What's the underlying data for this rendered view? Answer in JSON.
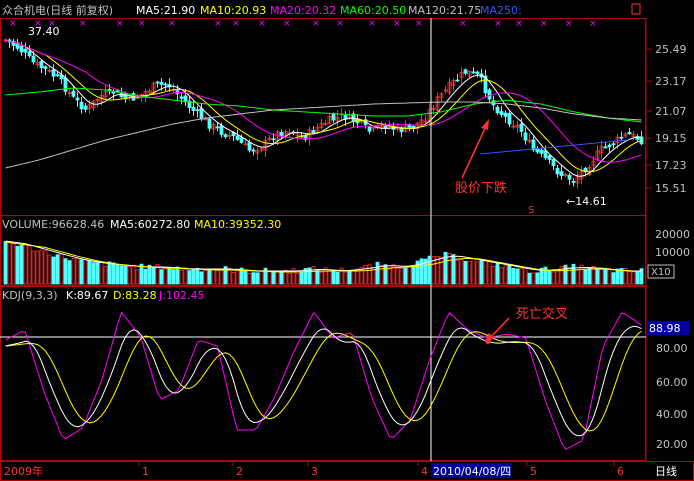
{
  "chart_data": {
    "type": "candlestick",
    "price_panel": {
      "title": "众合机电(日线 前复权)",
      "ma_labels": [
        {
          "text": "MA5:21.90",
          "color": "#ffffff"
        },
        {
          "text": "MA10:20.93",
          "color": "#ffff00"
        },
        {
          "text": "MA20:20.32",
          "color": "#ff00ff"
        },
        {
          "text": "MA60:20.50",
          "color": "#00ff00"
        },
        {
          "text": "MA120:21.75",
          "color": "#c0c0c0"
        },
        {
          "text": "MA250:",
          "color": "#3355ff"
        }
      ],
      "y_ticks": [
        "25.49",
        "23.17",
        "21.07",
        "19.15",
        "17.23",
        "15.51"
      ],
      "high_label": "37.40",
      "low_label": "←14.61",
      "annotation": "股价下跌",
      "marker_s": "S"
    },
    "volume_panel": {
      "label_volume": "VOLUME:96628.46",
      "label_ma5": "MA5:60272.80",
      "label_ma10": "MA10:39352.30",
      "y_ticks": [
        "20000",
        "10000"
      ],
      "unit": "X10"
    },
    "kdj_panel": {
      "label_name": "KDJ(9,3,3)",
      "label_k": "K:89.67",
      "label_d": "D:83.28",
      "label_j": "J:102.45",
      "y_ticks": [
        "80.00",
        "60.00",
        "40.00",
        "20.00"
      ],
      "cursor_value": "88.98",
      "annotation": "死亡交叉"
    },
    "x_axis": {
      "labels": [
        "2009年",
        "1",
        "2",
        "3",
        "4",
        "5",
        "6"
      ],
      "cursor_date": "2010/04/08/四",
      "period": "日线"
    }
  },
  "colors": {
    "up": "#ff3232",
    "down": "#54ffff",
    "grid": "#b40000",
    "k": "#ffffff",
    "d": "#ffff00",
    "j": "#ff00ff"
  }
}
